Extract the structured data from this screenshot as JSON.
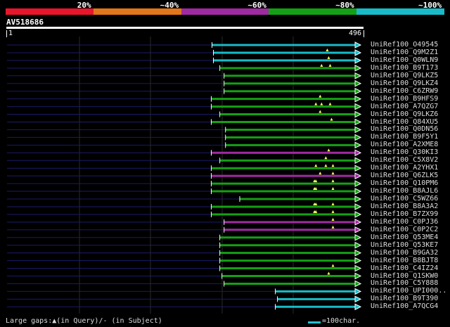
{
  "legend": {
    "segments": [
      {
        "color": "#e8162a",
        "label": "20%"
      },
      {
        "color": "#e2761a",
        "label": "~40%"
      },
      {
        "color": "#a02aa2",
        "label": "~60%"
      },
      {
        "color": "#14a014",
        "label": "~80%"
      },
      {
        "color": "#18bcc8",
        "label": "~100%"
      }
    ]
  },
  "query": {
    "id": "AV518686",
    "start": "1",
    "end": "496",
    "length": 496
  },
  "colors": {
    "background": "#000000",
    "baseline": "#1a1a6a",
    "arrow": "#ffffff",
    "gap_marker": "#ffff66"
  },
  "hits": [
    {
      "name": "UniRef100_O49545",
      "start": 288,
      "end": 496,
      "color": "#18bcc8",
      "gaps": []
    },
    {
      "name": "UniRef100_Q9M2Z1",
      "start": 290,
      "end": 496,
      "color": "#18bcc8",
      "gaps": [
        450
      ]
    },
    {
      "name": "UniRef100_Q0WLN9",
      "start": 290,
      "end": 496,
      "color": "#18bcc8",
      "gaps": [
        452
      ]
    },
    {
      "name": "UniRef100_B9T173",
      "start": 299,
      "end": 496,
      "color": "#14a014",
      "gaps": [
        442,
        454
      ]
    },
    {
      "name": "UniRef100_Q9LKZ5",
      "start": 305,
      "end": 496,
      "color": "#14a014",
      "gaps": []
    },
    {
      "name": "UniRef100_Q9LKZ4",
      "start": 305,
      "end": 496,
      "color": "#14a014",
      "gaps": []
    },
    {
      "name": "UniRef100_C6ZRW9",
      "start": 305,
      "end": 496,
      "color": "#14a014",
      "gaps": []
    },
    {
      "name": "UniRef100_B9HFS9",
      "start": 287,
      "end": 496,
      "color": "#14a014",
      "gaps": [
        440
      ]
    },
    {
      "name": "UniRef100_A7QZG7",
      "start": 287,
      "end": 496,
      "color": "#14a014",
      "gaps": [
        434,
        442,
        454
      ]
    },
    {
      "name": "UniRef100_Q9LKZ6",
      "start": 299,
      "end": 496,
      "color": "#14a014",
      "gaps": [
        440
      ]
    },
    {
      "name": "UniRef100_Q84XU5",
      "start": 287,
      "end": 496,
      "color": "#14a014",
      "gaps": [
        456
      ]
    },
    {
      "name": "UniRef100_Q0DN56",
      "start": 307,
      "end": 496,
      "color": "#14a014",
      "gaps": []
    },
    {
      "name": "UniRef100_B9F5Y1",
      "start": 307,
      "end": 496,
      "color": "#14a014",
      "gaps": []
    },
    {
      "name": "UniRef100_A2XME8",
      "start": 307,
      "end": 496,
      "color": "#14a014",
      "gaps": []
    },
    {
      "name": "UniRef100_Q30KI3",
      "start": 287,
      "end": 496,
      "color": "#a02aa2",
      "gaps": [
        452
      ]
    },
    {
      "name": "UniRef100_C5X8V2",
      "start": 299,
      "end": 496,
      "color": "#14a014",
      "gaps": [
        448
      ]
    },
    {
      "name": "UniRef100_A2YHX1",
      "start": 287,
      "end": 496,
      "color": "#14a014",
      "gaps": [
        434,
        448,
        458
      ]
    },
    {
      "name": "UniRef100_Q6ZLK5",
      "start": 287,
      "end": 496,
      "color": "#a02aa2",
      "gaps": [
        440,
        458
      ]
    },
    {
      "name": "UniRef100_Q10PM6",
      "start": 287,
      "end": 496,
      "color": "#14a014",
      "gaps": [
        432,
        434,
        458
      ]
    },
    {
      "name": "UniRef100_B8AJL6",
      "start": 287,
      "end": 496,
      "color": "#14a014",
      "gaps": [
        432,
        434,
        458
      ]
    },
    {
      "name": "UniRef100_C5WZ66",
      "start": 327,
      "end": 496,
      "color": "#14a014",
      "gaps": []
    },
    {
      "name": "UniRef100_B8A3A2",
      "start": 287,
      "end": 496,
      "color": "#14a014",
      "gaps": [
        432,
        434,
        458
      ]
    },
    {
      "name": "UniRef100_B7ZX99",
      "start": 287,
      "end": 496,
      "color": "#14a014",
      "gaps": [
        432,
        434,
        458
      ]
    },
    {
      "name": "UniRef100_C0PJ36",
      "start": 305,
      "end": 496,
      "color": "#a02aa2",
      "gaps": [
        458
      ]
    },
    {
      "name": "UniRef100_C0P2C2",
      "start": 305,
      "end": 496,
      "color": "#a02aa2",
      "gaps": [
        458
      ]
    },
    {
      "name": "UniRef100_Q53ME4",
      "start": 299,
      "end": 496,
      "color": "#14a014",
      "gaps": []
    },
    {
      "name": "UniRef100_Q53KE7",
      "start": 299,
      "end": 496,
      "color": "#14a014",
      "gaps": []
    },
    {
      "name": "UniRef100_B9GA32",
      "start": 299,
      "end": 496,
      "color": "#14a014",
      "gaps": []
    },
    {
      "name": "UniRef100_B8BJT8",
      "start": 299,
      "end": 496,
      "color": "#14a014",
      "gaps": []
    },
    {
      "name": "UniRef100_C4IZ24",
      "start": 299,
      "end": 496,
      "color": "#14a014",
      "gaps": [
        458
      ]
    },
    {
      "name": "UniRef100_Q1SKW0",
      "start": 302,
      "end": 496,
      "color": "#14a014",
      "gaps": [
        452
      ]
    },
    {
      "name": "UniRef100_C5Y888",
      "start": 305,
      "end": 496,
      "color": "#14a014",
      "gaps": []
    },
    {
      "name": "UniRef100_UPI000..",
      "start": 377,
      "end": 496,
      "color": "#18bcc8",
      "gaps": []
    },
    {
      "name": "UniRef100_B9T390",
      "start": 380,
      "end": 496,
      "color": "#18bcc8",
      "gaps": []
    },
    {
      "name": "UniRef100_A7QCG4",
      "start": 377,
      "end": 496,
      "color": "#18bcc8",
      "gaps": []
    }
  ],
  "footer": {
    "gaps_text": "Large gaps:▲(in Query)/- (in Subject)",
    "scale_text": "=100char."
  }
}
